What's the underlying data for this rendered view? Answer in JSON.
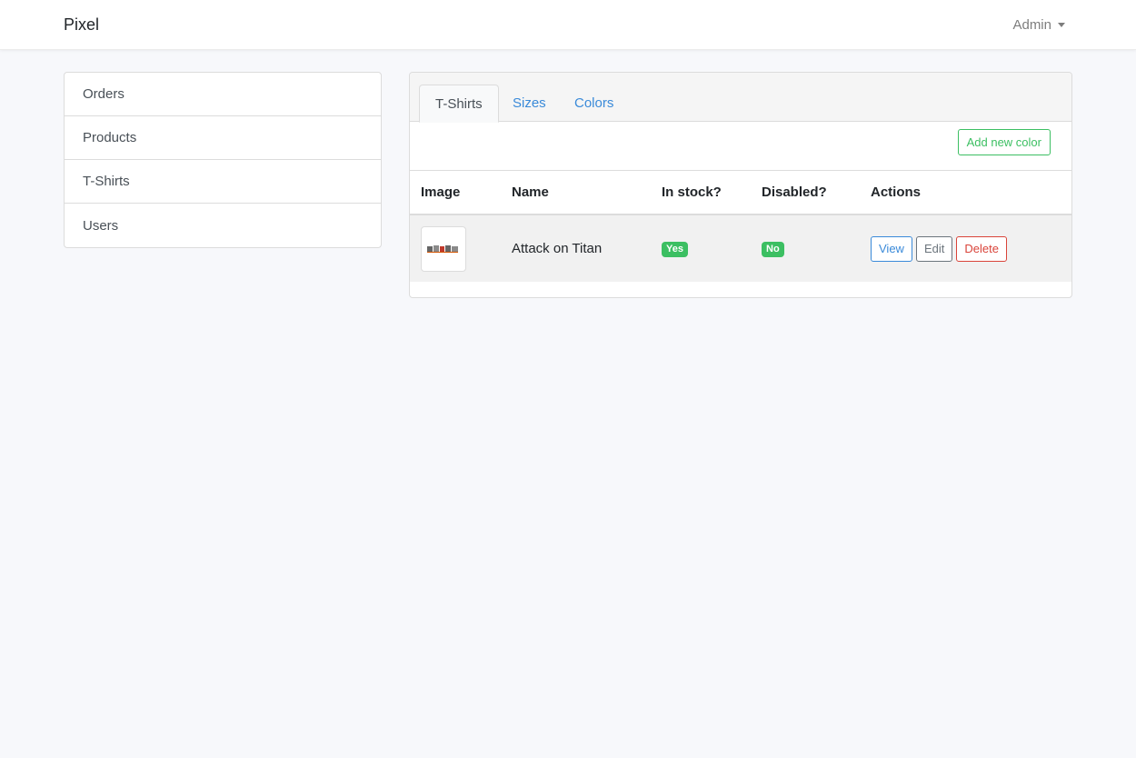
{
  "navbar": {
    "brand": "Pixel",
    "user_menu": "Admin"
  },
  "sidebar": {
    "items": [
      {
        "label": "Orders"
      },
      {
        "label": "Products"
      },
      {
        "label": "T-Shirts"
      },
      {
        "label": "Users"
      }
    ]
  },
  "tabs": [
    {
      "label": "T-Shirts",
      "active": true
    },
    {
      "label": "Sizes",
      "active": false
    },
    {
      "label": "Colors",
      "active": false
    }
  ],
  "toolbar": {
    "add_label": "Add new color"
  },
  "table": {
    "columns": [
      "Image",
      "Name",
      "In stock?",
      "Disabled?",
      "Actions"
    ],
    "rows": [
      {
        "name": "Attack on Titan",
        "in_stock": "Yes",
        "disabled": "No",
        "actions": {
          "view": "View",
          "edit": "Edit",
          "delete": "Delete"
        }
      }
    ]
  },
  "colors": {
    "accent": "#3a8ad9",
    "success": "#3cbf62",
    "danger": "#d9443a",
    "secondary": "#6c757d"
  }
}
